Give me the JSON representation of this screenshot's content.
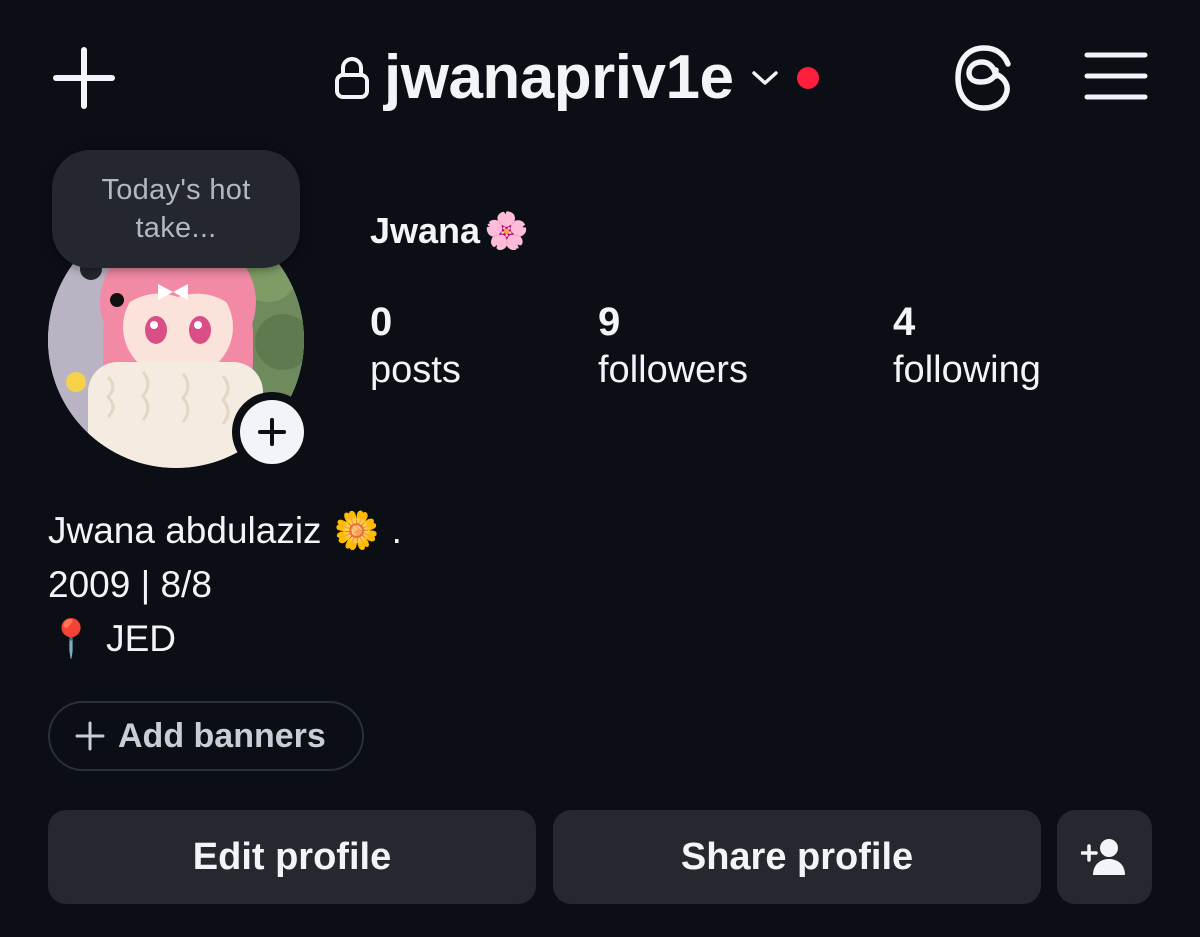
{
  "header": {
    "username": "jwanapriv1e",
    "icons": {
      "create": "plus-icon",
      "lock": "lock-icon",
      "account_switch": "chevron-down-icon",
      "threads": "threads-icon",
      "menu": "hamburger-menu-icon"
    },
    "notification_color": "#ff1f3d"
  },
  "profile": {
    "note_text": "Today's hot take...",
    "display_name": "Jwana",
    "display_name_emoji": "🌸",
    "stats": [
      {
        "count": "0",
        "label": "posts"
      },
      {
        "count": "9",
        "label": "followers"
      },
      {
        "count": "4",
        "label": "following"
      }
    ]
  },
  "bio": {
    "line1_text": "Jwana abdulaziz",
    "line1_emoji": "🌼",
    "line1_suffix": ".",
    "line2": "2009 | 8/8",
    "line3_emoji": "📍",
    "line3_text": "JED"
  },
  "banners": {
    "label": "Add banners"
  },
  "actions": {
    "edit_label": "Edit profile",
    "share_label": "Share profile",
    "add_person_icon": "add-person-icon"
  },
  "colors": {
    "background": "#0b0e14",
    "button": "#25282e",
    "text": "#f2f4f7"
  }
}
